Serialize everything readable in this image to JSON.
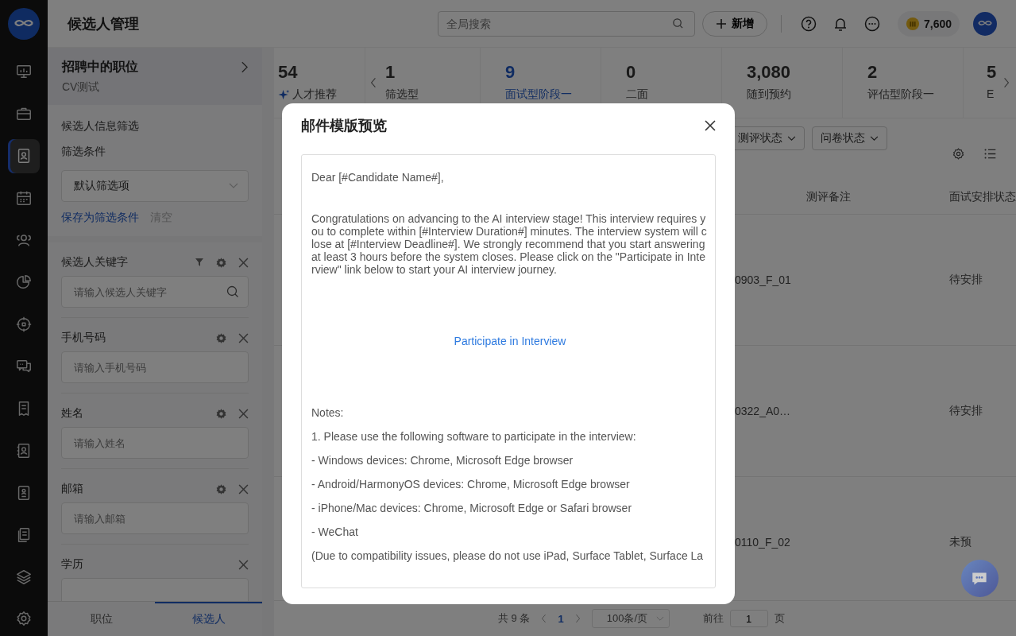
{
  "rail": {
    "items": [
      {
        "selected": false
      },
      {
        "selected": false
      },
      {
        "selected": true
      },
      {
        "selected": false
      },
      {
        "selected": false
      },
      {
        "selected": false
      },
      {
        "selected": false
      },
      {
        "selected": false
      },
      {
        "selected": false
      },
      {
        "selected": false
      },
      {
        "selected": false
      },
      {
        "selected": false
      },
      {
        "selected": false
      },
      {
        "selected": false
      }
    ]
  },
  "header": {
    "title": "候选人管理",
    "search": {
      "placeholder": "全局搜索"
    },
    "add_button": "新增",
    "coins": "7,600"
  },
  "position": {
    "heading": "招聘中的职位",
    "name": "CV测试"
  },
  "filters": {
    "heading": "候选人信息筛选",
    "condition_label": "筛选条件",
    "condition_value": "默认筛选项",
    "save_link": "保存为筛选条件",
    "clear_link": "清空",
    "fields": [
      {
        "label": "候选人关键字",
        "placeholder": "请输入候选人关键字",
        "has_filter": true,
        "has_settings": true,
        "has_search": true
      },
      {
        "label": "手机号码",
        "placeholder": "请输入手机号码",
        "has_filter": false,
        "has_settings": true,
        "has_search": false
      },
      {
        "label": "姓名",
        "placeholder": "请输入姓名",
        "has_filter": false,
        "has_settings": true,
        "has_search": false
      },
      {
        "label": "邮箱",
        "placeholder": "请输入邮箱",
        "has_filter": false,
        "has_settings": true,
        "has_search": false
      },
      {
        "label": "学历",
        "has_filter": false,
        "has_settings": false,
        "has_search": false
      }
    ]
  },
  "bottom_tabs": [
    {
      "label": "职位",
      "selected": false
    },
    {
      "label": "候选人",
      "selected": true
    }
  ],
  "stats": [
    {
      "value": "54",
      "label": "人才推荐",
      "sparkle": true,
      "selected": false
    },
    {
      "value": "1",
      "label": "筛选型",
      "sparkle": false,
      "selected": false
    },
    {
      "value": "9",
      "label": "面试型阶段一",
      "sparkle": false,
      "selected": true
    },
    {
      "value": "0",
      "label": "二面",
      "sparkle": false,
      "selected": false
    },
    {
      "value": "3,080",
      "label": "随到预约",
      "sparkle": false,
      "selected": false
    },
    {
      "value": "2",
      "label": "评估型阶段一",
      "sparkle": false,
      "selected": false
    },
    {
      "value": "5",
      "label": "E",
      "sparkle": false,
      "selected": false
    }
  ],
  "toolbar": {
    "dropdowns": [
      "测评状态",
      "问卷状态"
    ]
  },
  "table": {
    "columns": [
      "测评备注",
      "面试安排状态"
    ],
    "rows": [
      {
        "column_1": "0903_F_01",
        "status": "待安排"
      },
      {
        "column_1": "0322_A0…",
        "status": "待安排"
      },
      {
        "column_1": "0110_F_02",
        "status": "未预"
      }
    ]
  },
  "pagination": {
    "total": "共 9 条",
    "page": "1",
    "page_size": "100条/页",
    "goto_label": "前往",
    "goto_value": "1",
    "page_unit": "页"
  },
  "modal": {
    "title": "邮件模版预览",
    "body": [
      {
        "kind": "line",
        "text": "Dear [#Candidate Name#],"
      },
      {
        "kind": "paragraph",
        "text": "Congratulations on advancing to the AI interview stage! This interview requires you to complete within [#Interview Duration#] minutes. The interview system will close at [#Interview Deadline#]. We strongly recommend that you start answering at least 3 hours before the system closes. Please click on the \"Participate in Interview\" link below to start your AI interview journey."
      },
      {
        "kind": "link",
        "text": "Participate in Interview"
      },
      {
        "kind": "line",
        "text": "Notes:"
      },
      {
        "kind": "line",
        "text": "1. Please use the following software to participate in the interview:"
      },
      {
        "kind": "line",
        "text": "- Windows devices: Chrome, Microsoft Edge browser"
      },
      {
        "kind": "line",
        "text": "- Android/HarmonyOS devices: Chrome, Microsoft Edge browser"
      },
      {
        "kind": "line",
        "text": "- iPhone/Mac devices: Chrome, Microsoft Edge or Safari browser"
      },
      {
        "kind": "line",
        "text": "- WeChat"
      },
      {
        "kind": "line",
        "text": "(Due to compatibility issues, please do not use iPad, Surface Tablet, Surface La"
      }
    ]
  }
}
